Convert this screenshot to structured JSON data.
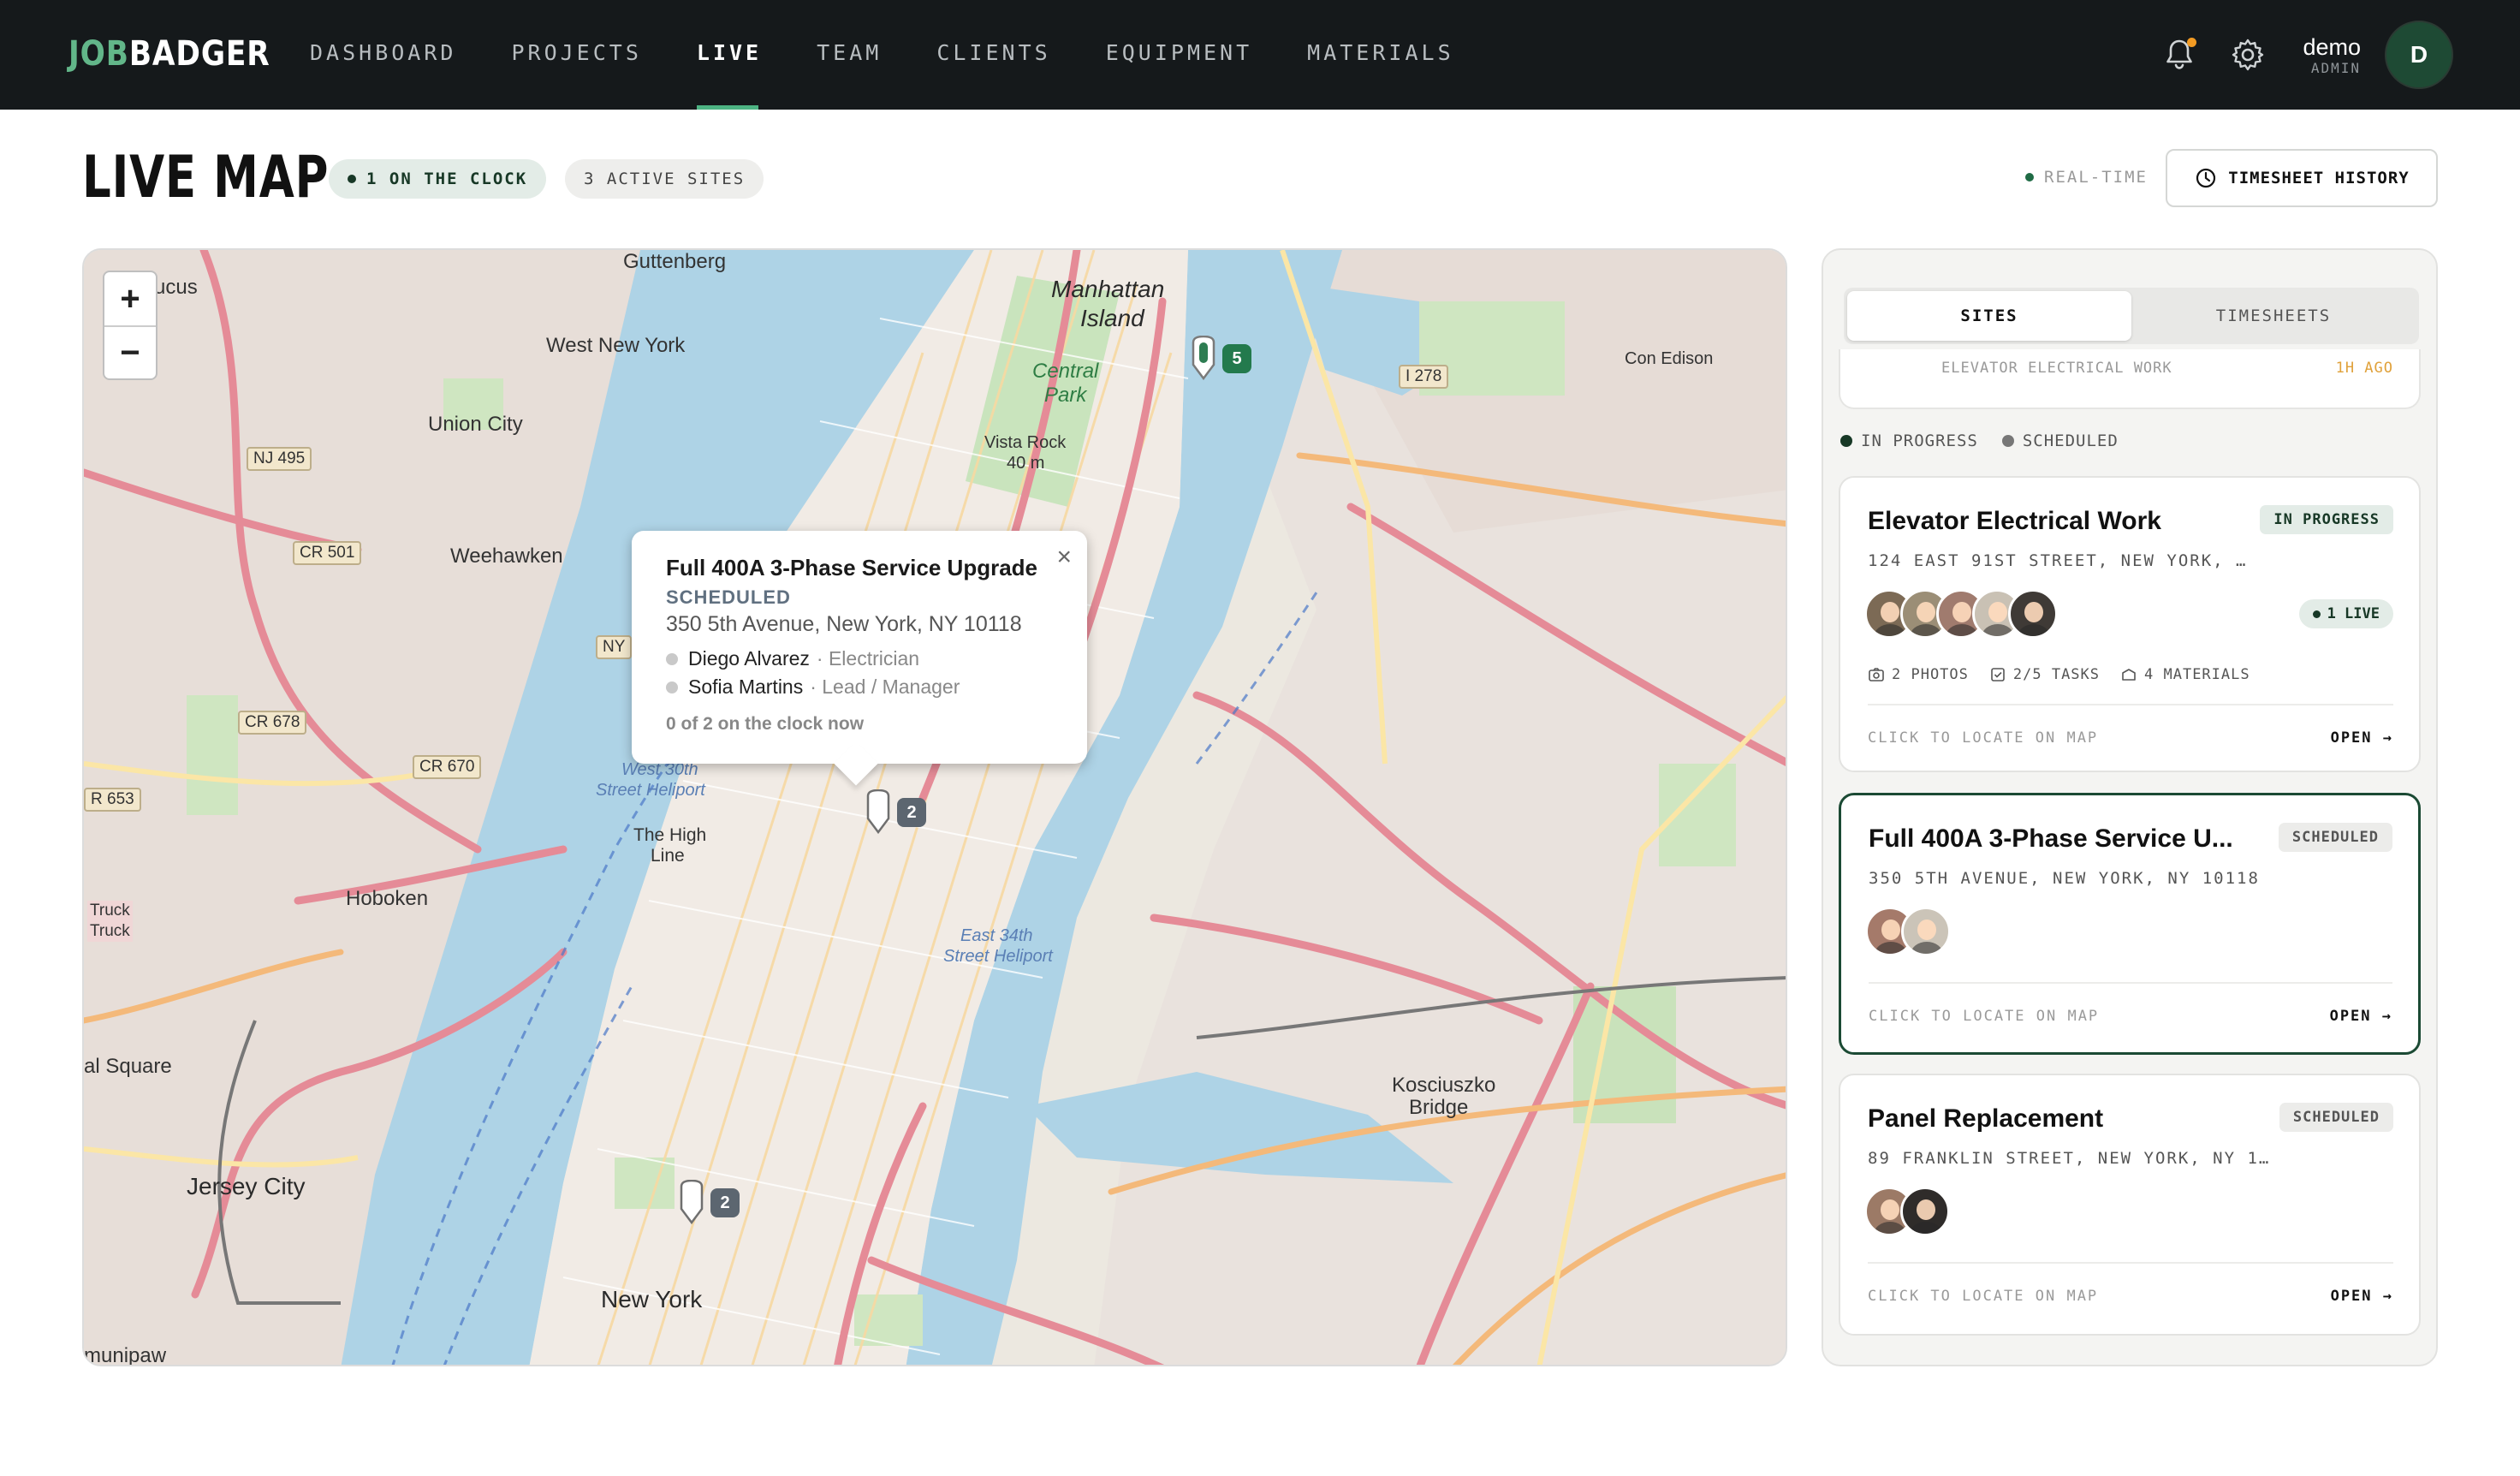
{
  "brand": {
    "prefix": "JOB",
    "suffix": "BADGER"
  },
  "nav": {
    "items": [
      {
        "label": "DASHBOARD"
      },
      {
        "label": "PROJECTS"
      },
      {
        "label": "LIVE",
        "active": true
      },
      {
        "label": "TEAM"
      },
      {
        "label": "CLIENTS"
      },
      {
        "label": "EQUIPMENT"
      },
      {
        "label": "MATERIALS"
      }
    ],
    "user": {
      "name": "demo",
      "role": "ADMIN",
      "initial": "D"
    },
    "icons": [
      "bell-icon",
      "gear-icon"
    ]
  },
  "header": {
    "title": "LIVE MAP",
    "on_clock": "1 ON THE CLOCK",
    "active_sites": "3 ACTIVE SITES",
    "realtime": "REAL-TIME",
    "timesheet_button": "TIMESHEET HISTORY"
  },
  "map": {
    "zoom_in": "+",
    "zoom_out": "−",
    "labels": {
      "manhattan": "Manhattan",
      "island": "Island",
      "guttenberg": "Guttenberg",
      "west_new_york": "West New York",
      "union_city": "Union City",
      "weehawken": "Weehawken",
      "hoboken": "Hoboken",
      "jersey_city": "Jersey City",
      "new_york": "New York",
      "central_park": "Central",
      "central_park2": "Park",
      "vista_rock": "Vista Rock",
      "vista_rock2": "40 m",
      "the_high_line": "The High",
      "the_high_line2": "Line",
      "kosciuszko": "Kosciuszko",
      "kosciuszko2": "Bridge",
      "con_edison": "Con Edison",
      "heliport_w": "West 30th",
      "heliport_w2": "Street Heliport",
      "heliport_e": "East 34th",
      "heliport_e2": "Street Heliport",
      "square": "al Square",
      "lucus": "ucus",
      "munipaw": "munipaw",
      "truck": "Truck",
      "truck2": "Truck",
      "nj495": "NJ 495",
      "cr501": "CR 501",
      "cr678": "CR 678",
      "cr670": "CR 670",
      "r653": "R 653",
      "ny": "NY",
      "i278": "I 278"
    },
    "markers": [
      {
        "count": "5",
        "color": "green"
      },
      {
        "count": "2",
        "color": "grey"
      },
      {
        "count": "2",
        "color": "grey"
      }
    ],
    "popup": {
      "title": "Full 400A 3-Phase Service Upgrade",
      "status": "SCHEDULED",
      "address": "350 5th Avenue, New York, NY 10118",
      "crew": [
        {
          "name": "Diego Alvarez",
          "role": "· Electrician"
        },
        {
          "name": "Sofia Martins",
          "role": "· Lead / Manager"
        }
      ],
      "footer": "0 of 2 on the clock now",
      "close": "×"
    }
  },
  "panel": {
    "tabs": [
      {
        "label": "SITES",
        "active": true
      },
      {
        "label": "TIMESHEETS"
      }
    ],
    "peek": {
      "text": "ELEVATOR ELECTRICAL WORK",
      "time": "1H AGO"
    },
    "legend": {
      "in_progress": "IN PROGRESS",
      "scheduled": "SCHEDULED"
    },
    "sites": [
      {
        "title": "Elevator Electrical Work",
        "status": "IN PROGRESS",
        "address": "124 EAST 91ST STREET, NEW YORK, …",
        "live": "1 LIVE",
        "photos": "2 PHOTOS",
        "tasks": "2/5 TASKS",
        "materials": "4 MATERIALS",
        "hint": "CLICK TO LOCATE ON MAP",
        "open": "OPEN →"
      },
      {
        "title": "Full 400A 3-Phase Service U...",
        "status": "SCHEDULED",
        "address": "350 5TH AVENUE, NEW YORK, NY 10118",
        "hint": "CLICK TO LOCATE ON MAP",
        "open": "OPEN →"
      },
      {
        "title": "Panel Replacement",
        "status": "SCHEDULED",
        "address": "89 FRANKLIN STREET, NEW YORK, NY 1…",
        "hint": "CLICK TO LOCATE ON MAP",
        "open": "OPEN →"
      }
    ]
  },
  "colors": {
    "nav_bg": "#15191b",
    "accent": "#4db383",
    "brand_green": "#1b4a34",
    "in_progress": "#173826",
    "scheduled": "#6b6b6b"
  }
}
